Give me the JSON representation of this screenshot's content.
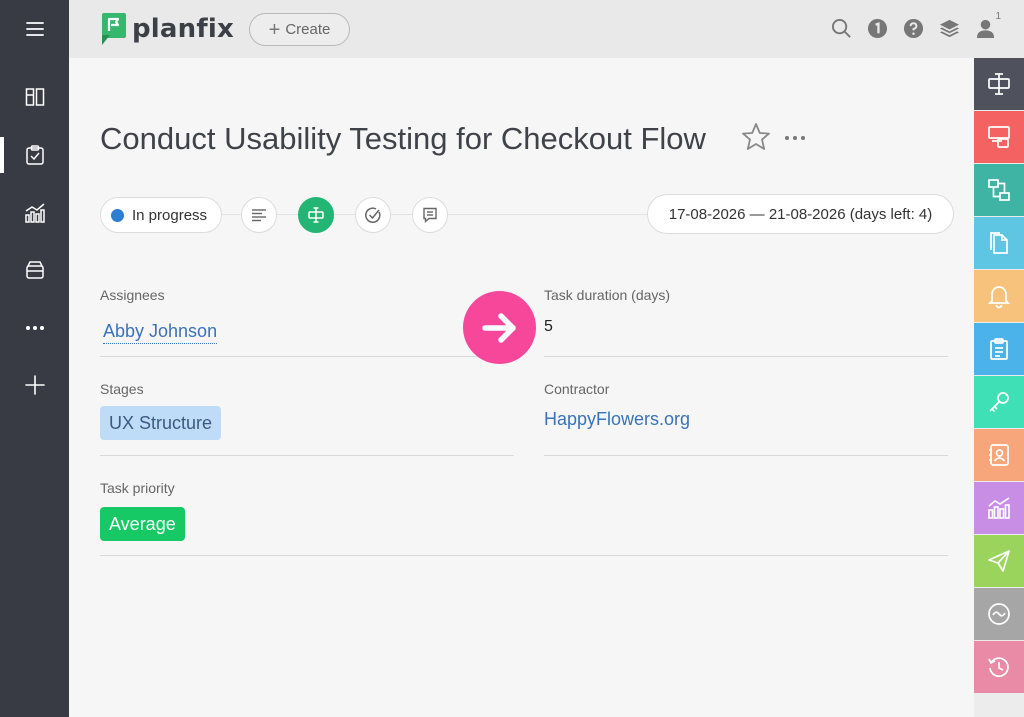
{
  "header": {
    "brand": "planfix",
    "create_label": "Create",
    "notification_count": "1"
  },
  "task": {
    "title": "Conduct Usability Testing for Checkout Flow",
    "status": "In progress",
    "status_color": "#2d7dd2",
    "date_range": "17-08-2026 — 21-08-2026  (days left: 4)"
  },
  "fields": {
    "assignees_label": "Assignees",
    "assignee": "Abby Johnson",
    "duration_label": "Task duration (days)",
    "duration": "5",
    "stages_label": "Stages",
    "stage": "UX Structure",
    "contractor_label": "Contractor",
    "contractor": "HappyFlowers.org",
    "priority_label": "Task priority",
    "priority": "Average"
  },
  "colors": {
    "sidebar_bg": "#383b44",
    "accent_green": "#22b573",
    "link_blue": "#3a73b8",
    "pointer_pink": "#f7479a"
  },
  "left_sidebar": {
    "icons": [
      "menu-icon",
      "dashboard-icon",
      "tasks-icon",
      "analytics-icon",
      "inbox-icon",
      "more-icon",
      "add-icon"
    ]
  },
  "right_toolbar": {
    "icons": [
      {
        "name": "task-icon",
        "color": "#4f525c"
      },
      {
        "name": "actions-icon",
        "color": "#f56262"
      },
      {
        "name": "processes-icon",
        "color": "#3fb3a4"
      },
      {
        "name": "documents-icon",
        "color": "#5ec6e2"
      },
      {
        "name": "notifications-icon",
        "color": "#f7c27c"
      },
      {
        "name": "checklist-icon",
        "color": "#4bb3ea"
      },
      {
        "name": "access-key-icon",
        "color": "#3fe0b6"
      },
      {
        "name": "contacts-icon",
        "color": "#f7a67c"
      },
      {
        "name": "reports-icon",
        "color": "#c88ee5"
      },
      {
        "name": "send-icon",
        "color": "#9ad45c"
      },
      {
        "name": "integrations-icon",
        "color": "#a6a6a6"
      },
      {
        "name": "history-icon",
        "color": "#e98aa6"
      }
    ]
  }
}
